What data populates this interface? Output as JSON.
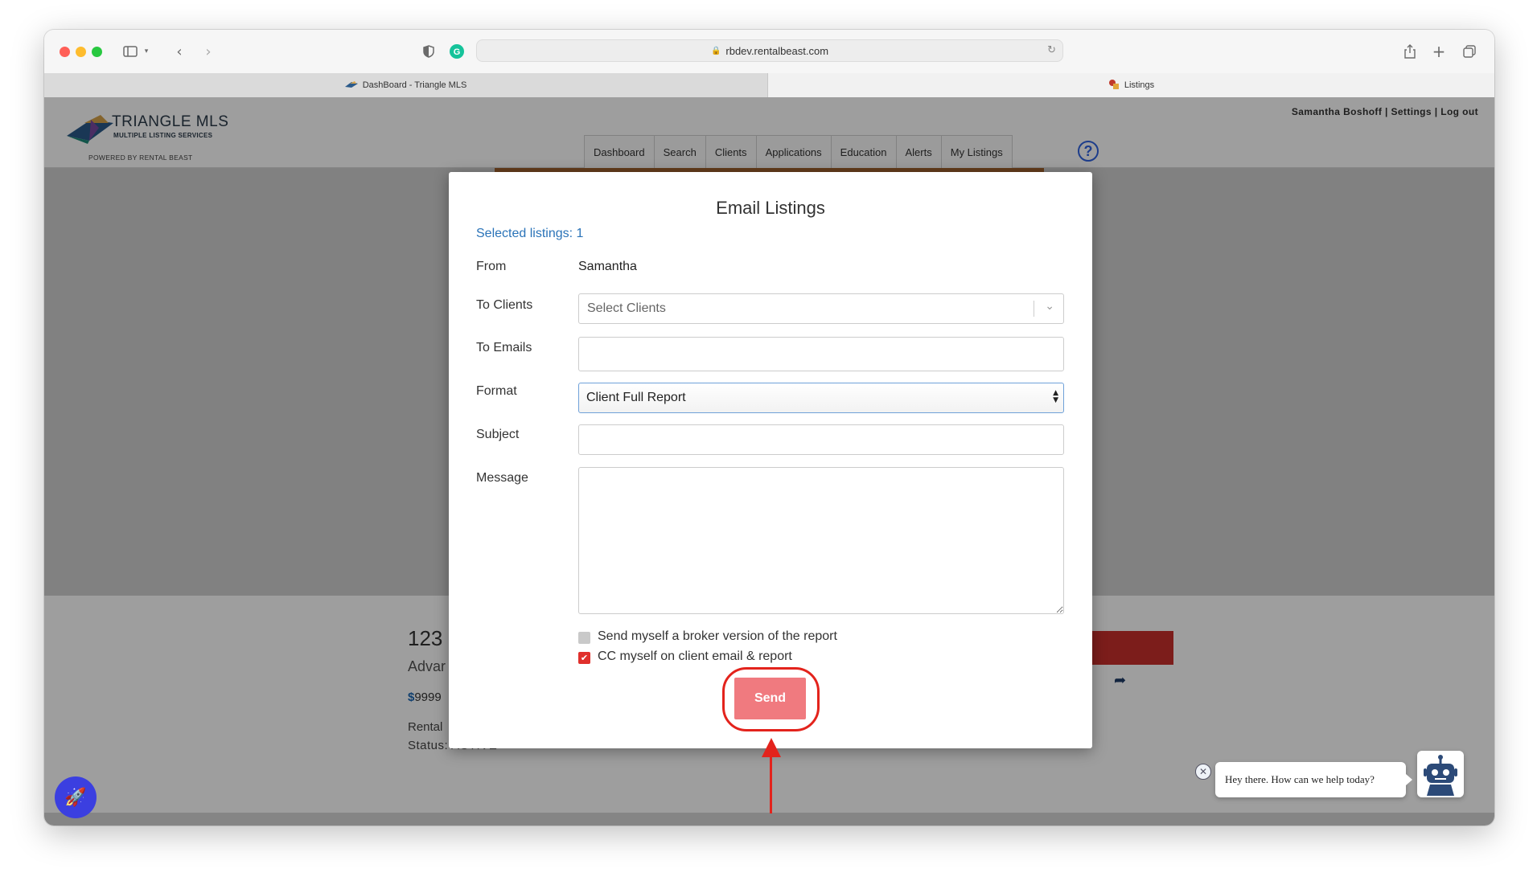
{
  "browser": {
    "url": "rbdev.rentalbeast.com",
    "tabs": [
      {
        "label": "DashBoard - Triangle MLS",
        "active": false
      },
      {
        "label": "Listings",
        "active": true
      }
    ]
  },
  "site": {
    "logo_title": "TRIANGLE MLS",
    "logo_subtitle": "MULTIPLE LISTING SERVICES",
    "powered_by": "POWERED BY RENTAL BEAST",
    "user_links": "Samantha Boshoff | Settings | Log out",
    "help": "?",
    "nav": [
      "Dashboard",
      "Search",
      "Clients",
      "Applications",
      "Education",
      "Alerts",
      "My Listings"
    ]
  },
  "listing": {
    "title_partial": "123",
    "subtitle_partial": "Advar",
    "price_symbol": "$",
    "price_partial": "9999",
    "type_partial": "Rental",
    "status": "Status: ACTIVE"
  },
  "modal": {
    "title": "Email Listings",
    "selected": "Selected listings: 1",
    "from_label": "From",
    "from_value": "Samantha",
    "to_clients_label": "To Clients",
    "to_clients_placeholder": "Select Clients",
    "to_emails_label": "To Emails",
    "to_emails_value": "",
    "format_label": "Format",
    "format_value": "Client Full Report",
    "subject_label": "Subject",
    "subject_value": "",
    "message_label": "Message",
    "message_value": "",
    "broker_checkbox_label": "Send myself a broker version of the report",
    "broker_checked": false,
    "cc_checkbox_label": "CC myself on client email & report",
    "cc_checked": true,
    "send_label": "Send"
  },
  "chat": {
    "greeting": "Hey there. How can we help today?"
  },
  "colors": {
    "accent_link": "#2a73b8",
    "send_button": "#f07a7f",
    "checkbox_checked": "#e0302c",
    "annotation_red": "#e3231c",
    "rocket_button": "#3b3fe0"
  }
}
